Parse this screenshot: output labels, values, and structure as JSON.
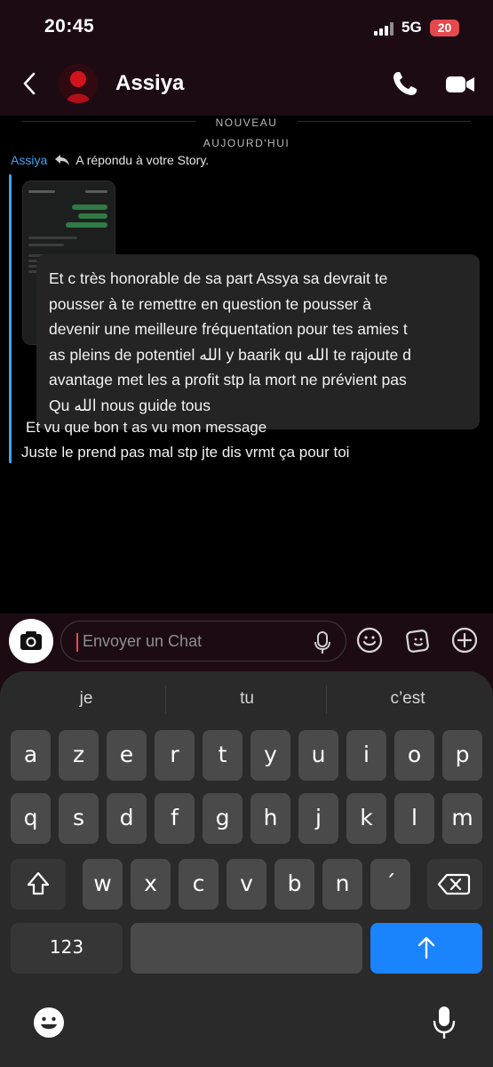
{
  "status_bar": {
    "time": "20:45",
    "network": "5G",
    "battery": "20"
  },
  "header": {
    "contact_name": "Assiya"
  },
  "chat": {
    "new_label": "NOUVEAU",
    "date_label": "AUJOURD'HUI",
    "reply_sender": "Assiya",
    "reply_text": "A répondu à votre Story.",
    "caption_lines": [
      "Et c très honorable de sa part Assya sa devrait te",
      "pousser à te remettre en question te pousser à",
      "devenir une meilleure fréquentation pour tes amies t",
      "as pleins de potentiel الله y baarik qu الله te rajoute d",
      "avantage met les a profit  stp la mort ne prévient pas",
      "Qu الله nous guide tous"
    ],
    "messages": [
      "Et vu que bon t as vu mon message",
      "Juste le prend pas mal stp jte dis vrmt ça pour toi"
    ]
  },
  "input": {
    "placeholder": "Envoyer un Chat"
  },
  "keyboard": {
    "suggestions": [
      "je",
      "tu",
      "c’est"
    ],
    "row1": [
      "a",
      "z",
      "e",
      "r",
      "t",
      "y",
      "u",
      "i",
      "o",
      "p"
    ],
    "row2": [
      "q",
      "s",
      "d",
      "f",
      "g",
      "h",
      "j",
      "k",
      "l",
      "m"
    ],
    "row3": [
      "w",
      "x",
      "c",
      "v",
      "b",
      "n",
      "´"
    ],
    "numbers_label": "123"
  },
  "colors": {
    "accent_blue": "#3ea3f2",
    "return_key": "#1a84ff",
    "header_bg": "#1d0b14",
    "battery": "#e5494d"
  }
}
